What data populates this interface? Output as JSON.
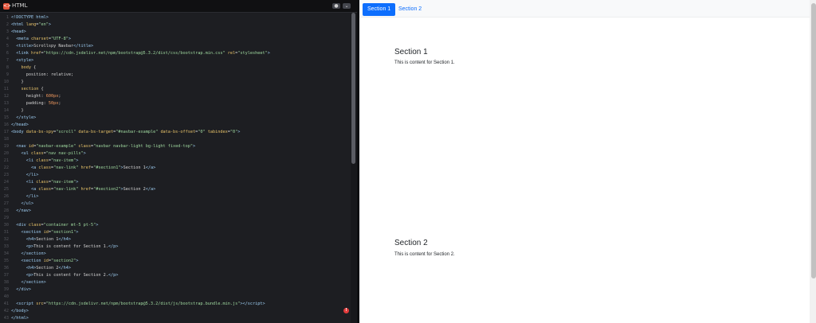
{
  "editor": {
    "title": "HTML",
    "icon": "html-icon",
    "settings_glyph": "●",
    "collapse_glyph": "⌄",
    "code_lines": [
      {
        "n": "1",
        "html": "<span class='tag'>&lt;!DOCTYPE html&gt;</span>"
      },
      {
        "n": "2",
        "html": "<span class='tag'>&lt;html</span> <span class='attr'>lang</span>=<span class='val'>\"en\"</span><span class='tag'>&gt;</span>"
      },
      {
        "n": "3",
        "html": "<span class='tag'>&lt;head&gt;</span>"
      },
      {
        "n": "4",
        "html": "  <span class='tag'>&lt;meta</span> <span class='attr'>charset</span>=<span class='val'>\"UTF-8\"</span><span class='tag'>&gt;</span>"
      },
      {
        "n": "5",
        "html": "  <span class='tag'>&lt;title&gt;</span>Scrollspy Navbar<span class='tag'>&lt;/title&gt;</span>"
      },
      {
        "n": "6",
        "html": "  <span class='tag'>&lt;link</span> <span class='attr'>href</span>=<span class='val'>\"https://cdn.jsdelivr.net/npm/bootstrap@5.3.2/dist/css/bootstrap.min.css\"</span> <span class='attr'>rel</span>=<span class='val'>\"stylesheet\"</span><span class='tag'>&gt;</span>"
      },
      {
        "n": "7",
        "html": "  <span class='tag'>&lt;style&gt;</span>"
      },
      {
        "n": "8",
        "html": "    <span class='attr'>body</span> {"
      },
      {
        "n": "9",
        "html": "      position: relative;"
      },
      {
        "n": "10",
        "html": "    }"
      },
      {
        "n": "11",
        "html": "    <span class='attr'>section</span> {"
      },
      {
        "n": "12",
        "html": "      height: <span class='num'>600px</span>;"
      },
      {
        "n": "13",
        "html": "      padding: <span class='num'>50px</span>;"
      },
      {
        "n": "14",
        "html": "    }"
      },
      {
        "n": "15",
        "html": "  <span class='tag'>&lt;/style&gt;</span>"
      },
      {
        "n": "16",
        "html": "<span class='tag'>&lt;/head&gt;</span>"
      },
      {
        "n": "17",
        "html": "<span class='tag'>&lt;body</span> <span class='attr'>data-bs-spy</span>=<span class='val'>\"scroll\"</span> <span class='attr'>data-bs-target</span>=<span class='val'>\"#navbar-example\"</span> <span class='attr'>data-bs-offset</span>=<span class='val'>\"0\"</span> <span class='attr'>tabindex</span>=<span class='val'>\"0\"</span><span class='tag'>&gt;</span>"
      },
      {
        "n": "18",
        "html": ""
      },
      {
        "n": "19",
        "html": "  <span class='tag'>&lt;nav</span> <span class='attr'>id</span>=<span class='val'>\"navbar-example\"</span> <span class='attr'>class</span>=<span class='val'>\"navbar navbar-light bg-light fixed-top\"</span><span class='tag'>&gt;</span>"
      },
      {
        "n": "20",
        "html": "    <span class='tag'>&lt;ul</span> <span class='attr'>class</span>=<span class='val'>\"nav nav-pills\"</span><span class='tag'>&gt;</span>"
      },
      {
        "n": "21",
        "html": "      <span class='tag'>&lt;li</span> <span class='attr'>class</span>=<span class='val'>\"nav-item\"</span><span class='tag'>&gt;</span>"
      },
      {
        "n": "22",
        "html": "        <span class='tag'>&lt;a</span> <span class='attr'>class</span>=<span class='val'>\"nav-link\"</span> <span class='attr'>href</span>=<span class='val'>\"#section1\"</span><span class='tag'>&gt;</span>Section 1<span class='tag'>&lt;/a&gt;</span>"
      },
      {
        "n": "23",
        "html": "      <span class='tag'>&lt;/li&gt;</span>"
      },
      {
        "n": "24",
        "html": "      <span class='tag'>&lt;li</span> <span class='attr'>class</span>=<span class='val'>\"nav-item\"</span><span class='tag'>&gt;</span>"
      },
      {
        "n": "25",
        "html": "        <span class='tag'>&lt;a</span> <span class='attr'>class</span>=<span class='val'>\"nav-link\"</span> <span class='attr'>href</span>=<span class='val'>\"#section2\"</span><span class='tag'>&gt;</span>Section 2<span class='tag'>&lt;/a&gt;</span>"
      },
      {
        "n": "26",
        "html": "      <span class='tag'>&lt;/li&gt;</span>"
      },
      {
        "n": "27",
        "html": "    <span class='tag'>&lt;/ul&gt;</span>"
      },
      {
        "n": "28",
        "html": "  <span class='tag'>&lt;/nav&gt;</span>"
      },
      {
        "n": "29",
        "html": ""
      },
      {
        "n": "30",
        "html": "  <span class='tag'>&lt;div</span> <span class='attr'>class</span>=<span class='val'>\"container mt-5 pt-5\"</span><span class='tag'>&gt;</span>"
      },
      {
        "n": "31",
        "html": "    <span class='tag'>&lt;section</span> <span class='attr'>id</span>=<span class='val'>\"section1\"</span><span class='tag'>&gt;</span>"
      },
      {
        "n": "32",
        "html": "      <span class='tag'>&lt;h4&gt;</span>Section 1<span class='tag'>&lt;/h4&gt;</span>"
      },
      {
        "n": "33",
        "html": "      <span class='tag'>&lt;p&gt;</span>This is content for Section 1.<span class='tag'>&lt;/p&gt;</span>"
      },
      {
        "n": "34",
        "html": "    <span class='tag'>&lt;/section&gt;</span>"
      },
      {
        "n": "35",
        "html": "    <span class='tag'>&lt;section</span> <span class='attr'>id</span>=<span class='val'>\"section2\"</span><span class='tag'>&gt;</span>"
      },
      {
        "n": "36",
        "html": "      <span class='tag'>&lt;h4&gt;</span>Section 2<span class='tag'>&lt;/h4&gt;</span>"
      },
      {
        "n": "37",
        "html": "      <span class='tag'>&lt;p&gt;</span>This is content for Section 2.<span class='tag'>&lt;/p&gt;</span>"
      },
      {
        "n": "38",
        "html": "    <span class='tag'>&lt;/section&gt;</span>"
      },
      {
        "n": "39",
        "html": "  <span class='tag'>&lt;/div&gt;</span>"
      },
      {
        "n": "40",
        "html": ""
      },
      {
        "n": "41",
        "html": "  <span class='tag'>&lt;script</span> <span class='attr'>src</span>=<span class='val'>\"https://cdn.jsdelivr.net/npm/bootstrap@5.3.2/dist/js/bootstrap.bundle.min.js\"</span><span class='tag'>&gt;&lt;/script&gt;</span>"
      },
      {
        "n": "42",
        "html": "<span class='tag'>&lt;/body&gt;</span>"
      },
      {
        "n": "43",
        "html": "<span class='tag'>&lt;/html&gt;</span>"
      }
    ],
    "error_glyph": "!"
  },
  "preview": {
    "nav": {
      "items": [
        {
          "label": "Section 1",
          "active": true
        },
        {
          "label": "Section 2",
          "active": false
        }
      ]
    },
    "sections": [
      {
        "title": "Section 1",
        "text": "This is content for Section 1."
      },
      {
        "title": "Section 2",
        "text": "This is content for Section 2."
      }
    ]
  },
  "colors": {
    "accent": "#0d6efd",
    "editor_bg": "#1d1e22",
    "error": "#e23b3b"
  }
}
